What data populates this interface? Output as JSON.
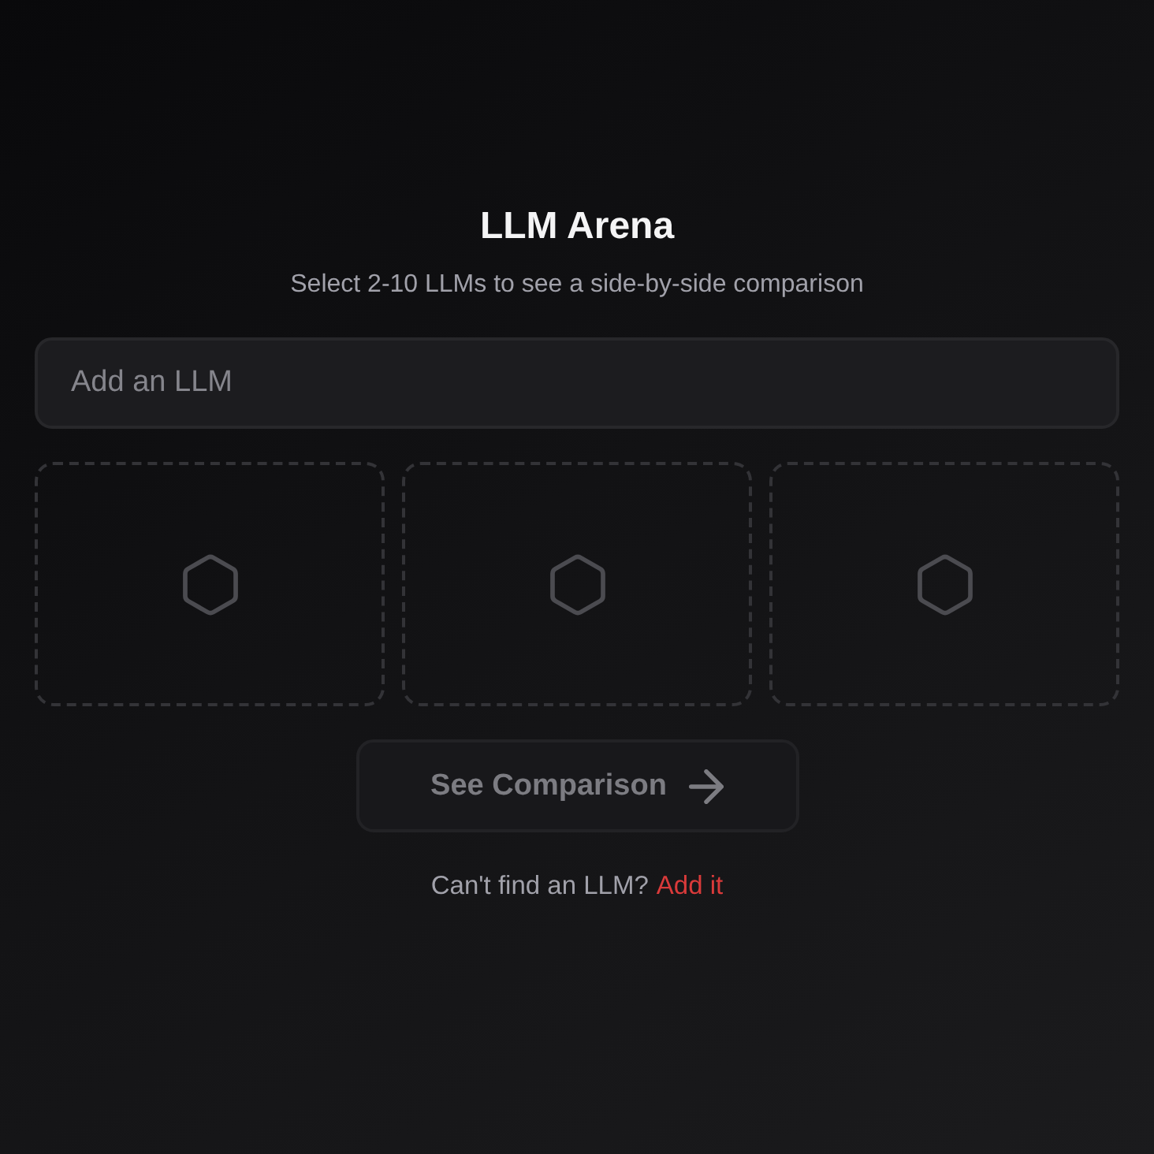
{
  "title": "LLM Arena",
  "subtitle": "Select 2-10 LLMs to see a side-by-side comparison",
  "search": {
    "placeholder": "Add an LLM"
  },
  "slots": [
    {
      "filled": false
    },
    {
      "filled": false
    },
    {
      "filled": false
    }
  ],
  "compare_button": {
    "label": "See Comparison",
    "disabled": true
  },
  "footer": {
    "text": "Can't find an LLM?",
    "link": "Add it"
  }
}
